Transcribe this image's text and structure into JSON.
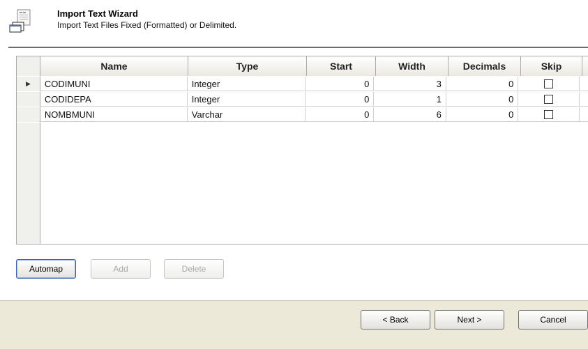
{
  "header": {
    "title": "Import Text Wizard",
    "subtitle": "Import Text Files Fixed (Formatted) or Delimited.",
    "icon": "import-wizard-icon"
  },
  "grid": {
    "columns": [
      "Name",
      "Type",
      "Start",
      "Width",
      "Decimals",
      "Skip"
    ],
    "rows": [
      {
        "name": "CODIMUNI",
        "type": "Integer",
        "start": "0",
        "width": "3",
        "decimals": "0",
        "skip": false,
        "current": true
      },
      {
        "name": "CODIDEPA",
        "type": "Integer",
        "start": "0",
        "width": "1",
        "decimals": "0",
        "skip": false,
        "current": false
      },
      {
        "name": "NOMBMUNI",
        "type": "Varchar",
        "start": "0",
        "width": "6",
        "decimals": "0",
        "skip": false,
        "current": false
      }
    ]
  },
  "buttons": {
    "automap": "Automap",
    "add": "Add",
    "delete": "Delete",
    "back": "< Back",
    "next": "Next >",
    "cancel": "Cancel"
  },
  "colors": {
    "footer_bg": "#ece9d8",
    "focus_border": "#3d64a8"
  }
}
